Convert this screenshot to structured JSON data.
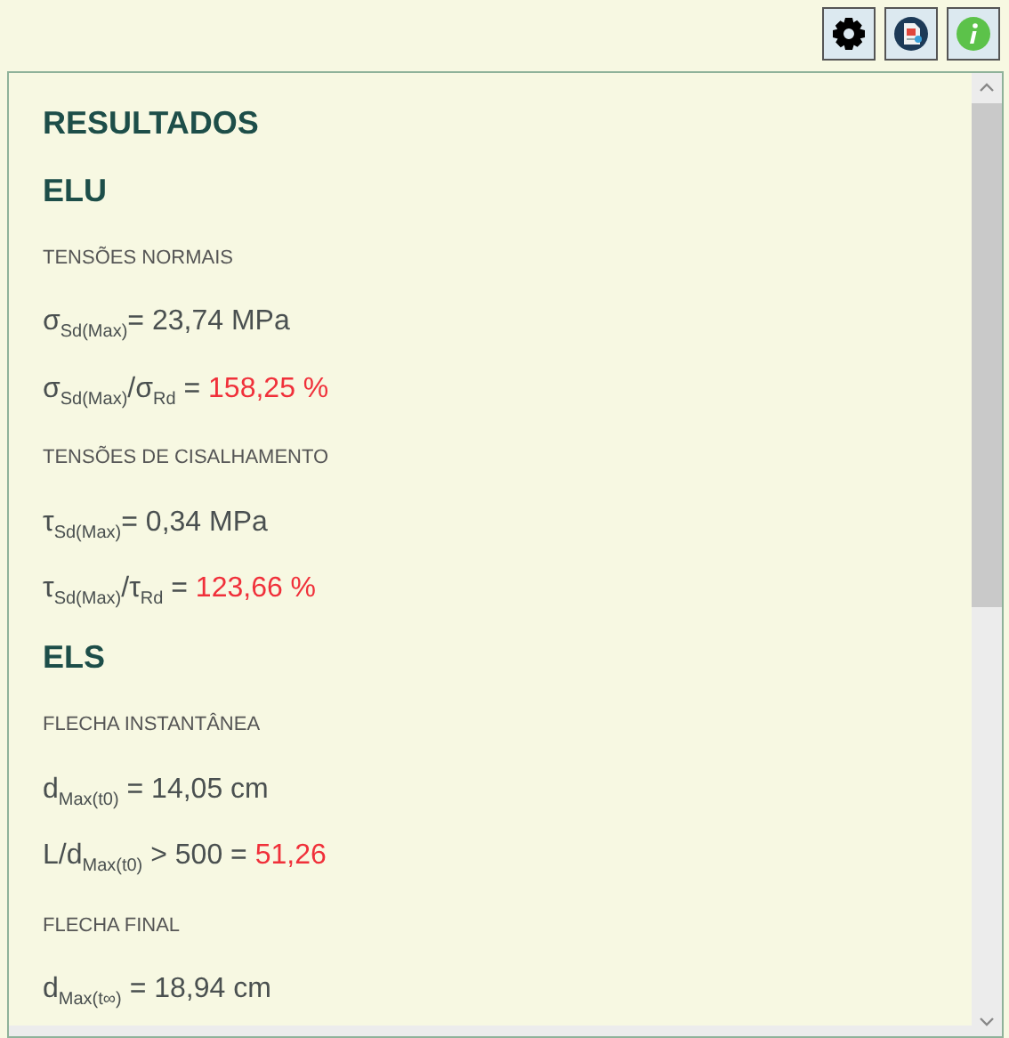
{
  "toolbar": {
    "buttons": [
      {
        "kind": "settings"
      },
      {
        "kind": "report"
      },
      {
        "kind": "info"
      }
    ]
  },
  "results": [
    {
      "kind": "title",
      "text": "RESULTADOS"
    },
    {
      "kind": "section",
      "text": "ELU"
    },
    {
      "kind": "subheading",
      "text": "TENSÕES NORMAIS"
    },
    {
      "kind": "formula",
      "text": "σ$_{Sd(Max)}$= 23,74 MPa"
    },
    {
      "kind": "formula",
      "text": "σ$_{Sd(Max)}$/σ$_{Rd}$ = ",
      "result": "158,25 %",
      "alert": true
    },
    {
      "kind": "subheading",
      "text": "TENSÕES DE CISALHAMENTO"
    },
    {
      "kind": "formula",
      "text": "τ$_{Sd(Max)}$= 0,34 MPa"
    },
    {
      "kind": "formula",
      "text": "τ$_{Sd(Max)}$/τ$_{Rd}$ = ",
      "result": "123,66 %",
      "alert": true
    },
    {
      "kind": "section",
      "text": "ELS"
    },
    {
      "kind": "subheading",
      "text": "FLECHA INSTANTÂNEA"
    },
    {
      "kind": "formula",
      "text": "d$_{Max(t0)}$ = 14,05 cm"
    },
    {
      "kind": "formula",
      "text": "L/d$_{Max(t0)}$ > 500 = ",
      "result": "51,26",
      "alert": true
    },
    {
      "kind": "subheading",
      "text": "FLECHA FINAL"
    },
    {
      "kind": "formula",
      "text": "d$_{Max(t∞)}$ = 18,94 cm"
    }
  ]
}
